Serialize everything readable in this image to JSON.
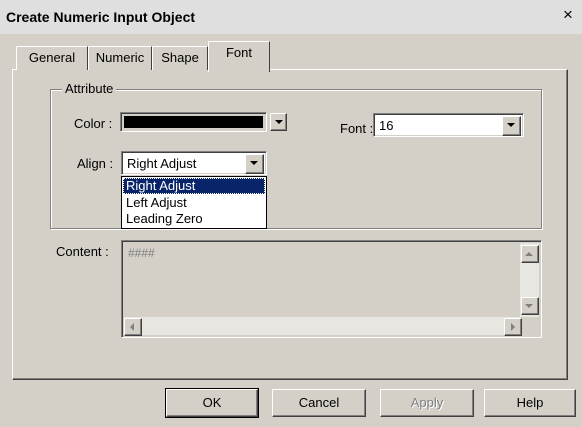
{
  "window": {
    "title": "Create Numeric Input Object",
    "close_label": "×"
  },
  "tabs": [
    {
      "label": "General"
    },
    {
      "label": "Numeric"
    },
    {
      "label": "Shape"
    },
    {
      "label": "Font"
    }
  ],
  "attribute": {
    "group_label": "Attribute",
    "color_label": "Color :",
    "color_value": "#000000",
    "font_label": "Font :",
    "font_value": "16",
    "align_label": "Align :",
    "align_value": "Right Adjust",
    "align_options": [
      "Right Adjust",
      "Left Adjust",
      "Leading Zero"
    ]
  },
  "content": {
    "label": "Content :",
    "value": "####"
  },
  "buttons": {
    "ok": "OK",
    "cancel": "Cancel",
    "apply": "Apply",
    "help": "Help"
  }
}
